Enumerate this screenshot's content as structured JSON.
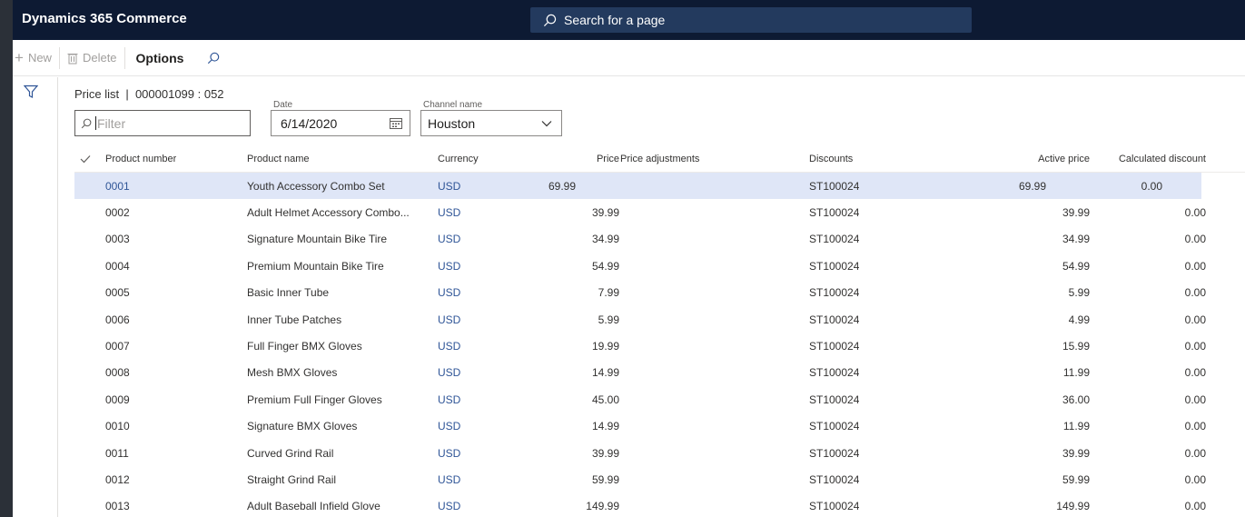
{
  "app": {
    "title": "Dynamics 365 Commerce"
  },
  "search": {
    "placeholder": "Search for a page"
  },
  "actions": {
    "new": "New",
    "delete": "Delete",
    "options": "Options"
  },
  "caption": "Price list  |  000001099 : 052",
  "filters": {
    "filter_placeholder": "Filter",
    "date_label": "Date",
    "date_value": "6/14/2020",
    "channel_label": "Channel name",
    "channel_value": "Houston"
  },
  "columns": {
    "product_number": "Product number",
    "product_name": "Product name",
    "currency": "Currency",
    "price": "Price",
    "price_adjustments": "Price adjustments",
    "discounts": "Discounts",
    "active_price": "Active price",
    "calculated_discount": "Calculated discount"
  },
  "rows": [
    {
      "num": "0001",
      "name": "Youth Accessory Combo Set",
      "cur": "USD",
      "price": "69.99",
      "disc": "ST100024",
      "active": "69.99",
      "calc": "0.00"
    },
    {
      "num": "0002",
      "name": "Adult Helmet Accessory Combo...",
      "cur": "USD",
      "price": "39.99",
      "disc": "ST100024",
      "active": "39.99",
      "calc": "0.00"
    },
    {
      "num": "0003",
      "name": "Signature Mountain Bike Tire",
      "cur": "USD",
      "price": "34.99",
      "disc": "ST100024",
      "active": "34.99",
      "calc": "0.00"
    },
    {
      "num": "0004",
      "name": "Premium Mountain Bike Tire",
      "cur": "USD",
      "price": "54.99",
      "disc": "ST100024",
      "active": "54.99",
      "calc": "0.00"
    },
    {
      "num": "0005",
      "name": "Basic Inner Tube",
      "cur": "USD",
      "price": "7.99",
      "disc": "ST100024",
      "active": "5.99",
      "calc": "0.00"
    },
    {
      "num": "0006",
      "name": "Inner Tube Patches",
      "cur": "USD",
      "price": "5.99",
      "disc": "ST100024",
      "active": "4.99",
      "calc": "0.00"
    },
    {
      "num": "0007",
      "name": "Full Finger BMX Gloves",
      "cur": "USD",
      "price": "19.99",
      "disc": "ST100024",
      "active": "15.99",
      "calc": "0.00"
    },
    {
      "num": "0008",
      "name": "Mesh BMX Gloves",
      "cur": "USD",
      "price": "14.99",
      "disc": "ST100024",
      "active": "11.99",
      "calc": "0.00"
    },
    {
      "num": "0009",
      "name": "Premium Full Finger Gloves",
      "cur": "USD",
      "price": "45.00",
      "disc": "ST100024",
      "active": "36.00",
      "calc": "0.00"
    },
    {
      "num": "0010",
      "name": "Signature BMX Gloves",
      "cur": "USD",
      "price": "14.99",
      "disc": "ST100024",
      "active": "11.99",
      "calc": "0.00"
    },
    {
      "num": "0011",
      "name": "Curved Grind Rail",
      "cur": "USD",
      "price": "39.99",
      "disc": "ST100024",
      "active": "39.99",
      "calc": "0.00"
    },
    {
      "num": "0012",
      "name": "Straight Grind Rail",
      "cur": "USD",
      "price": "59.99",
      "disc": "ST100024",
      "active": "59.99",
      "calc": "0.00"
    },
    {
      "num": "0013",
      "name": "Adult Baseball Infield Glove",
      "cur": "USD",
      "price": "149.99",
      "disc": "ST100024",
      "active": "149.99",
      "calc": "0.00"
    }
  ],
  "colors": {
    "topbar": "#0d1a33",
    "search": "#233a5e",
    "selected_row": "#dfe6f7",
    "link": "#2f5597"
  }
}
